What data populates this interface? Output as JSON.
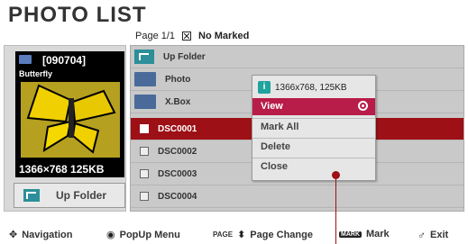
{
  "title": "PHOTO LIST",
  "header": {
    "page": "Page 1/1",
    "marked": "No Marked"
  },
  "preview": {
    "date": "[090704]",
    "name": "Butterfly",
    "resolution": "1366×768  125KB"
  },
  "left_button": {
    "label": "Up Folder"
  },
  "files": [
    {
      "type": "upfolder",
      "name": "Up Folder"
    },
    {
      "type": "folder",
      "name": "Photo"
    },
    {
      "type": "folder",
      "name": "X.Box"
    },
    {
      "type": "file",
      "name": "DSC0001",
      "selected": true
    },
    {
      "type": "file",
      "name": "DSC0002"
    },
    {
      "type": "file",
      "name": "DSC0003"
    },
    {
      "type": "file",
      "name": "DSC0004"
    }
  ],
  "popup": {
    "info_icon": "i",
    "info": "1366x768, 125KB",
    "items": [
      "View",
      "Mark All",
      "Delete",
      "Close"
    ],
    "highlighted": "View"
  },
  "bottom": {
    "navigation": "Navigation",
    "popup_menu": "PopUp Menu",
    "page_badge": "PAGE",
    "page_change": "Page Change",
    "mark_badge": "MARK",
    "mark": "Mark",
    "exit": "Exit"
  },
  "colors": {
    "selected_row": "#9c1016",
    "popup_highlight": "#b81c48",
    "icon_teal": "#2c8f99"
  }
}
